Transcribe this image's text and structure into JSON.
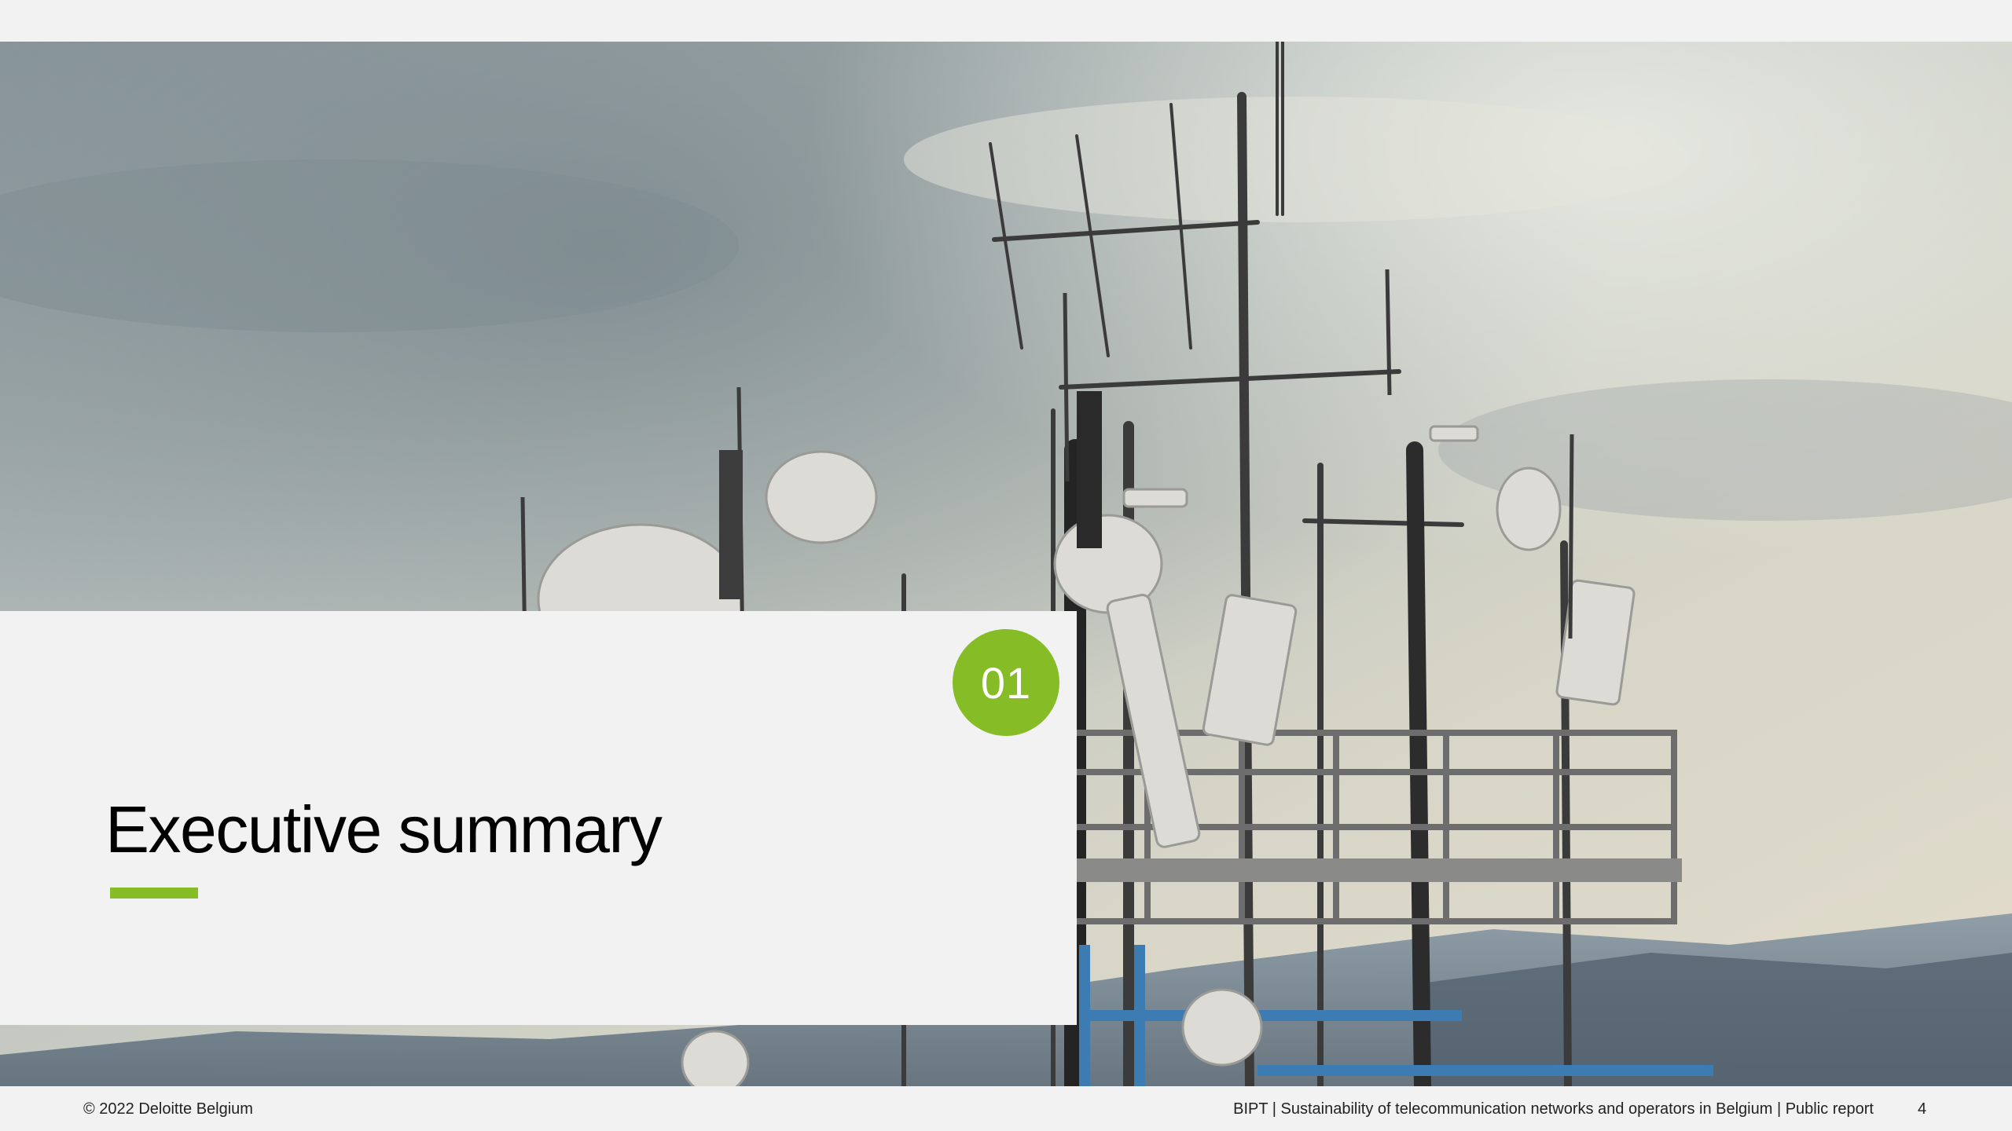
{
  "slide": {
    "section_number": "01",
    "section_title": "Executive summary",
    "accent_color": "#86bc25",
    "background_image": "telecom-antenna-tower-photo"
  },
  "footer": {
    "copyright": "© 2022 Deloitte Belgium",
    "report_title": "BIPT | Sustainability of telecommunication networks and operators in Belgium | Public report",
    "page_number": "4"
  }
}
